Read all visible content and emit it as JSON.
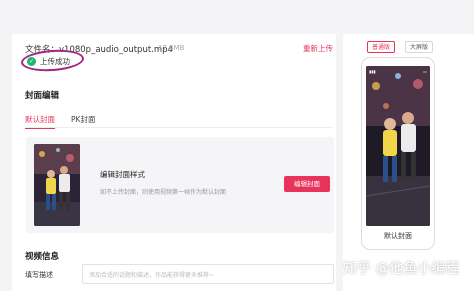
{
  "file": {
    "label": "文件名：",
    "name": "v1080p_audio_output.mp4",
    "size": "17.4MB",
    "reupload": "重新上传",
    "status": "上传成功"
  },
  "cover": {
    "section_title": "封面编辑",
    "tabs": [
      {
        "label": "默认封面",
        "active": true
      },
      {
        "label": "PK封面",
        "active": false
      }
    ],
    "style_title": "编辑封面样式",
    "style_desc": "如不上传封面，则使用视频第一帧作为默认封面",
    "edit_button": "编辑封面"
  },
  "video_info": {
    "section_title": "视频信息",
    "desc_label": "填写描述",
    "desc_placeholder": "添加合适的话题和描述，作品能获得更多推荐~"
  },
  "preview": {
    "mode_normal": "普通版",
    "mode_large": "大屏版",
    "phone_label": "默认封面"
  },
  "watermark": "知乎 @他鱼小编程",
  "colors": {
    "accent": "#e8345c",
    "success": "#22b573",
    "highlight_ring": "#a3267a"
  }
}
